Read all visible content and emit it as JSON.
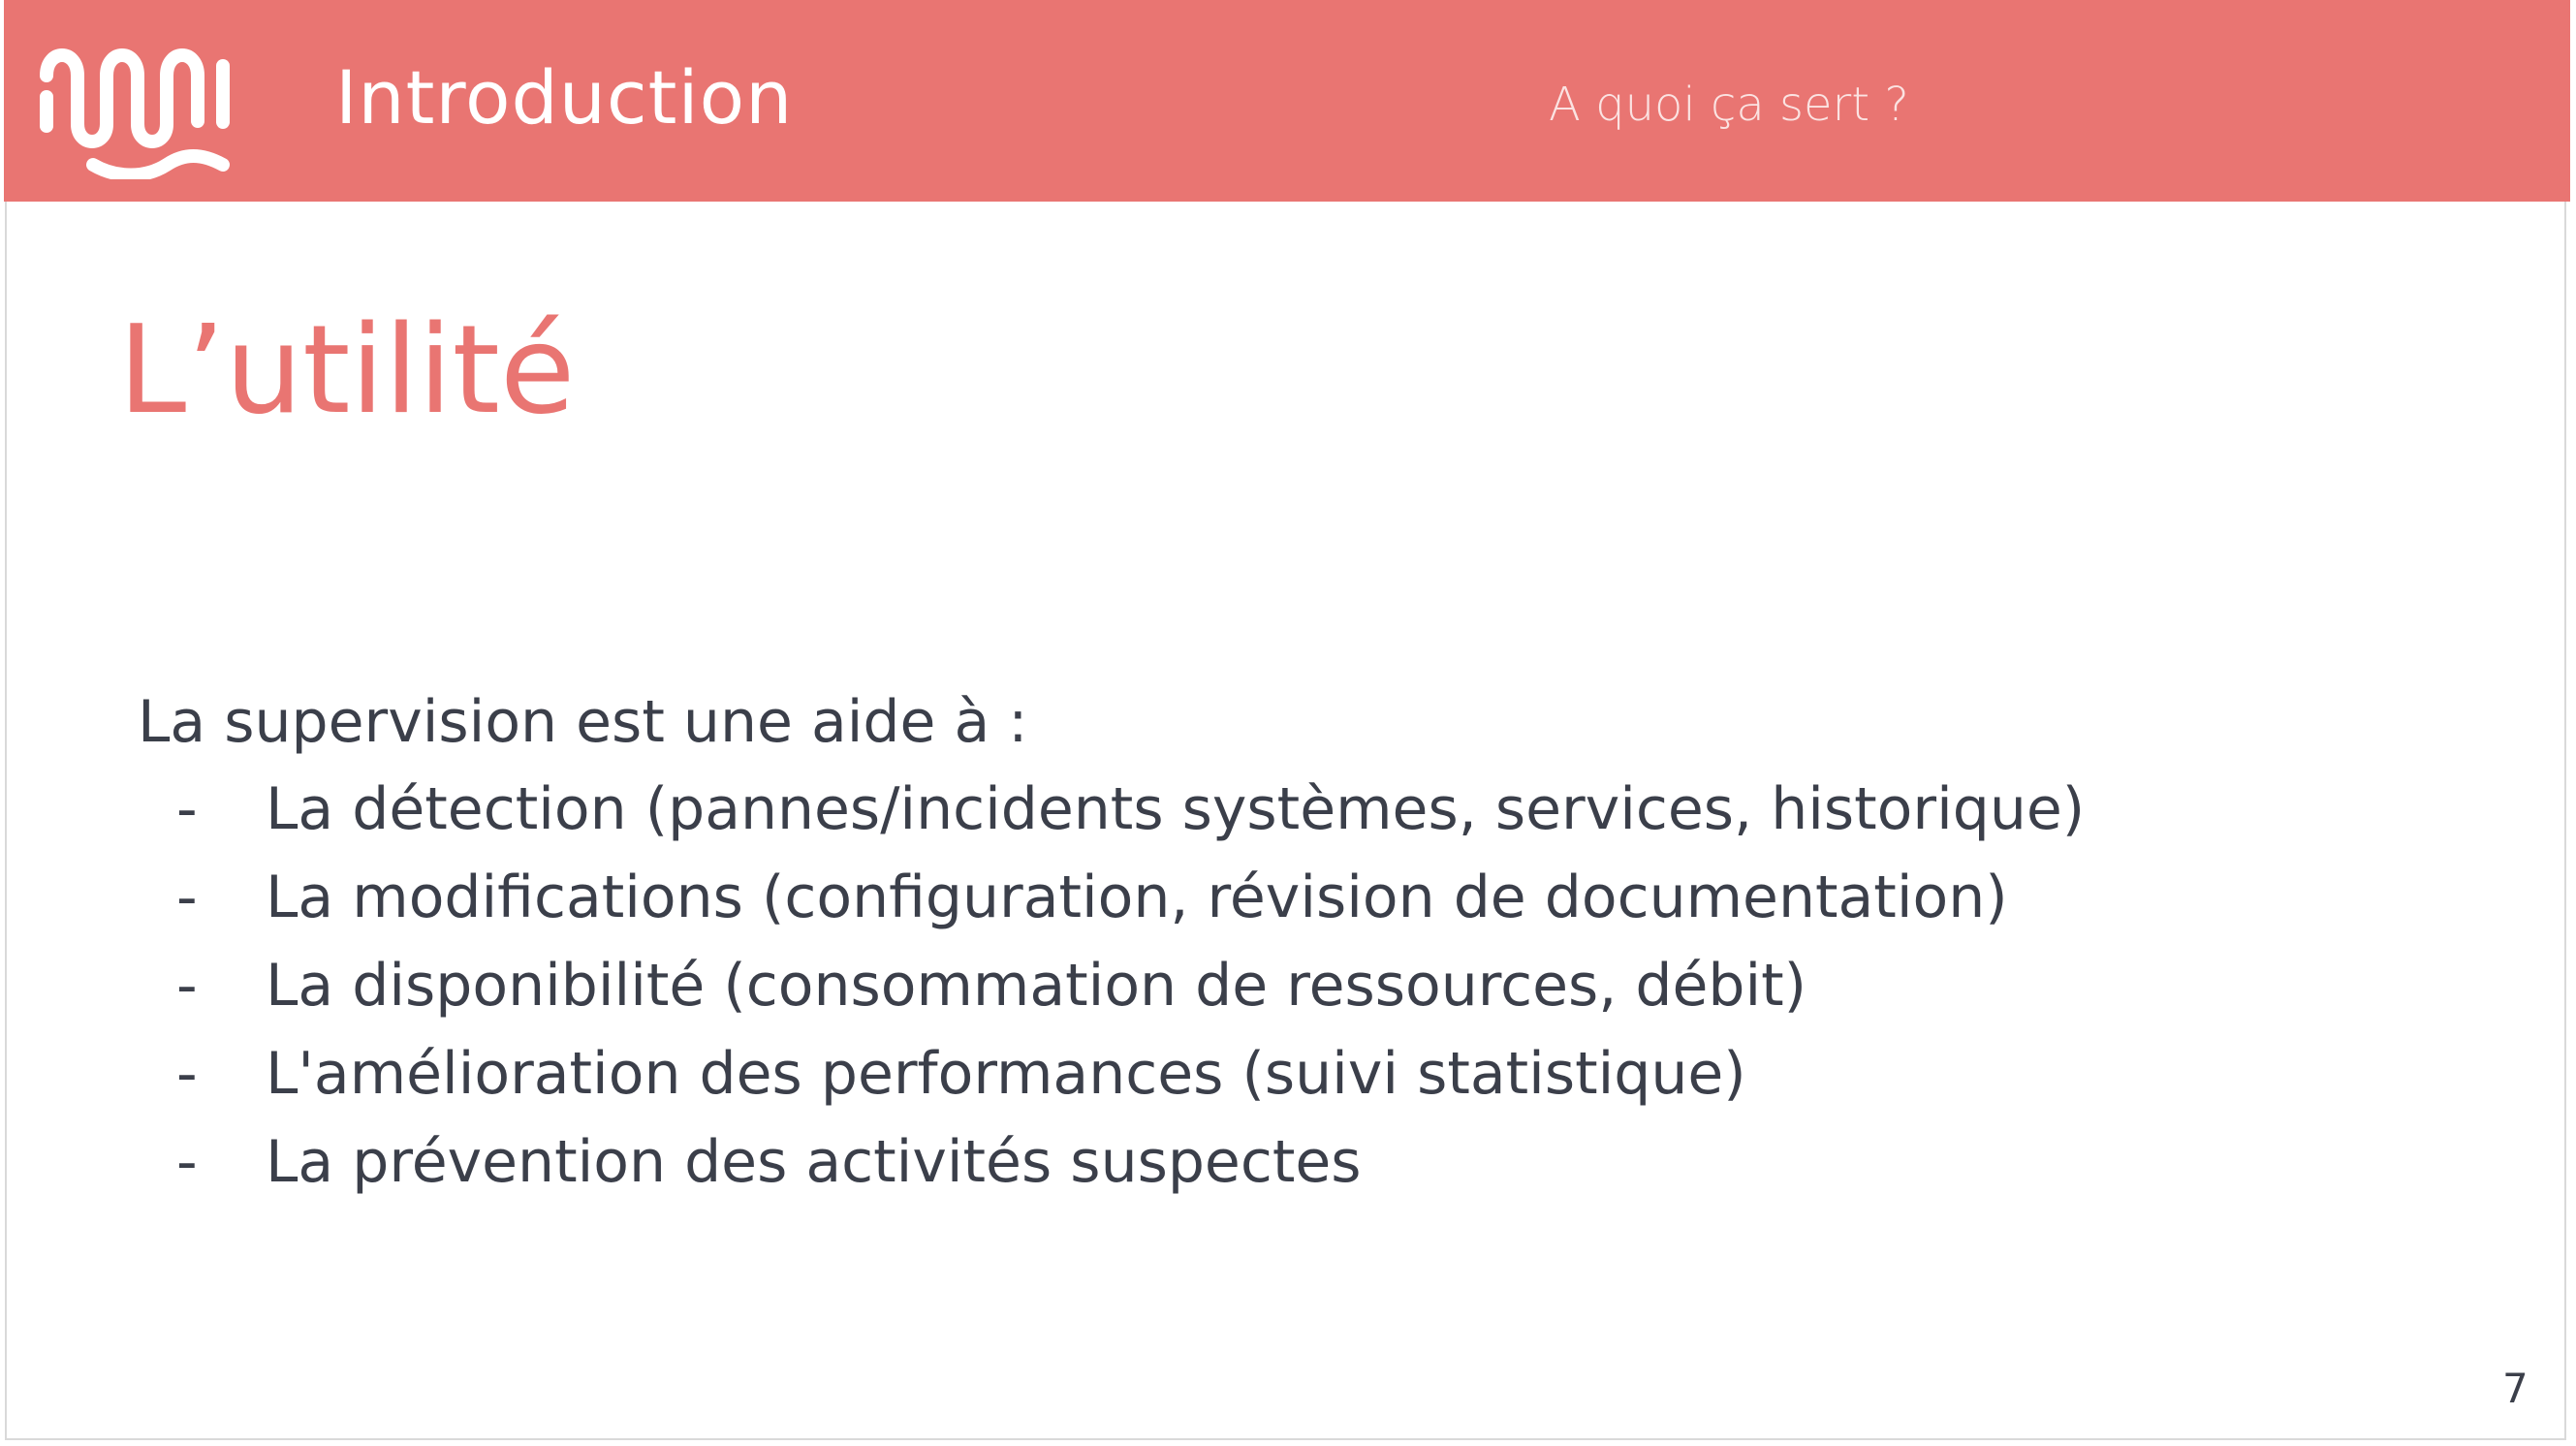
{
  "header": {
    "section_title": "Introduction",
    "section_subtitle": "A quoi ça sert ?",
    "logo_icon": "wave-logo-icon",
    "background_color": "#e97572"
  },
  "main": {
    "title": "L’utilité",
    "intro": "La supervision est une aide à :",
    "bullet_marker": "-",
    "bullets": [
      "La détection (pannes/incidents systèmes, services, historique)",
      "La modifications (configuration, révision de documentation)",
      "La disponibilité (consommation de ressources, débit)",
      "L'amélioration des performances (suivi statistique)",
      "La prévention des activités suspectes"
    ]
  },
  "footer": {
    "page_number": "7"
  },
  "colors": {
    "accent": "#e97572",
    "text": "#3b3f4a"
  }
}
